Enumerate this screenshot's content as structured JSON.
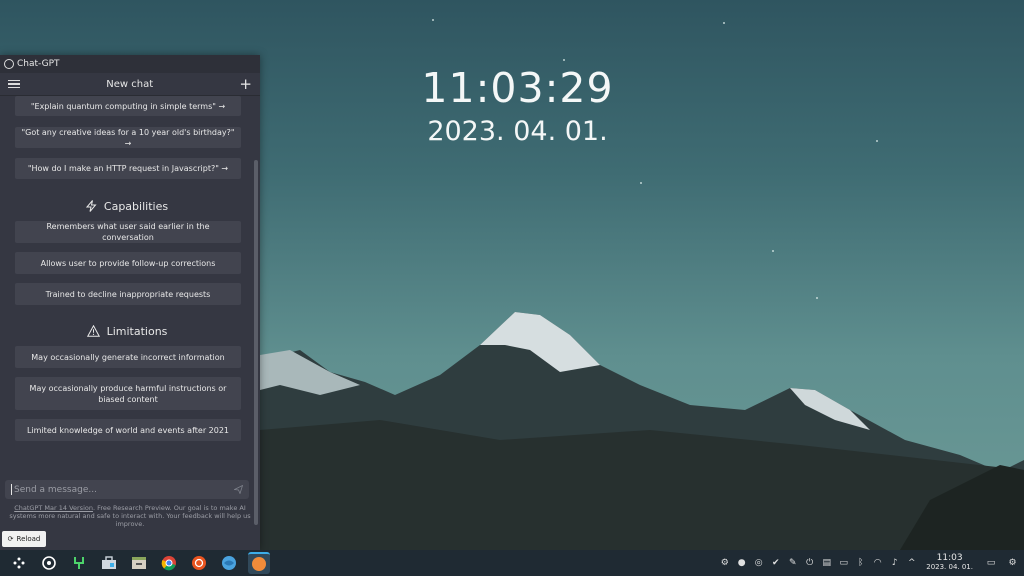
{
  "window": {
    "app_title": "Chat-GPT",
    "header_title": "New chat"
  },
  "examples": [
    "\"Explain quantum computing in simple terms\" →",
    "\"Got any creative ideas for a 10 year old's birthday?\" →",
    "\"How do I make an HTTP request in Javascript?\" →"
  ],
  "capabilities": {
    "title": "Capabilities",
    "items": [
      "Remembers what user said earlier in the conversation",
      "Allows user to provide follow-up corrections",
      "Trained to decline inappropriate requests"
    ]
  },
  "limitations": {
    "title": "Limitations",
    "items": [
      "May occasionally generate incorrect information",
      "May occasionally produce harmful instructions or biased content",
      "Limited knowledge of world and events after 2021"
    ]
  },
  "input": {
    "placeholder": "Send a message..."
  },
  "footer": {
    "link": "ChatGPT Mar 14 Version",
    "text": ". Free Research Preview. Our goal is to make AI systems more natural and safe to interact with. Your feedback will help us improve."
  },
  "reload_label": "Reload",
  "desktop": {
    "time": "11:03:29",
    "date": "2023. 04. 01."
  },
  "taskbar": {
    "clock_time": "11:03",
    "clock_date": "2023. 04. 01.",
    "apps": [
      "launcher-icon",
      "chatgpt-icon",
      "dev-icon",
      "store-icon",
      "files-icon",
      "chrome-icon",
      "software-center-icon",
      "browser-icon",
      "compass-icon"
    ]
  },
  "colors": {
    "accent": "#3daee9",
    "window_bg": "#353742",
    "card_bg": "#42444f"
  }
}
